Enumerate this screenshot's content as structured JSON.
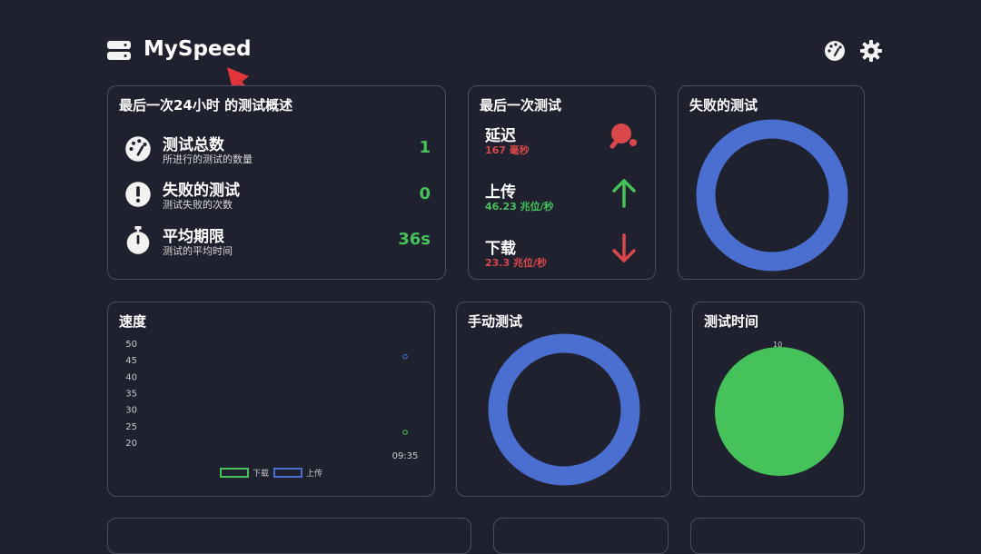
{
  "header": {
    "title": "MySpeed"
  },
  "summary": {
    "title": "最后一次24小时 的测试概述",
    "items": [
      {
        "label": "测试总数",
        "sub": "所进行的测试的数量",
        "value": "1"
      },
      {
        "label": "失败的测试",
        "sub": "测试失败的次数",
        "value": "0"
      },
      {
        "label": "平均期限",
        "sub": "测试的平均时间",
        "value": "36s"
      }
    ]
  },
  "latest": {
    "title": "最后一次测试",
    "ping": {
      "label": "延迟",
      "value": "167 毫秒",
      "color": "#d9474a"
    },
    "upload": {
      "label": "上传",
      "value": "46.23 兆位/秒",
      "color": "#45c25a"
    },
    "download": {
      "label": "下载",
      "value": "23.3 兆位/秒",
      "color": "#d9474a"
    }
  },
  "failed_card": {
    "title": "失败的测试",
    "ring_color": "#4a6fd0"
  },
  "manual_card": {
    "title": "手动测试",
    "ring_color": "#4a6fd0"
  },
  "time_card": {
    "title": "测试时间",
    "pie_label": "10",
    "pie_color": "#45c25a"
  },
  "speed_card": {
    "title": "速度"
  },
  "chart_data": {
    "type": "line",
    "title": "速度",
    "x": [
      "09:35"
    ],
    "ylim": [
      20,
      50
    ],
    "yticks": [
      "50",
      "45",
      "40",
      "35",
      "30",
      "25",
      "20"
    ],
    "series": [
      {
        "name": "下载",
        "values": [
          23.3
        ],
        "color": "#45c25a"
      },
      {
        "name": "上传",
        "values": [
          46.23
        ],
        "color": "#4a6fd0"
      }
    ],
    "legend": "bottom"
  }
}
